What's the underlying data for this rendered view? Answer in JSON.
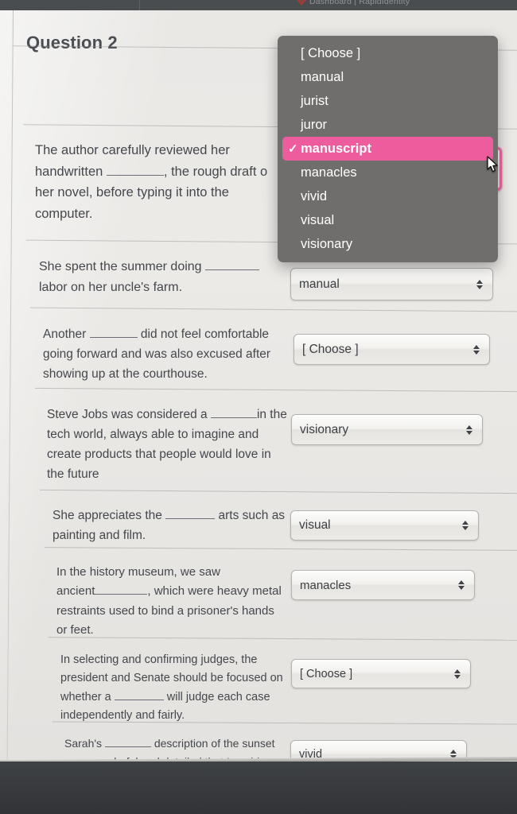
{
  "browser": {
    "title": "Dashboard | RapidIdentity",
    "logo_icon": "red-logo-icon"
  },
  "page": {
    "heading": "Question 2"
  },
  "dropdown": {
    "open": true,
    "selected_value": "manuscript",
    "check_glyph": "✓",
    "highlight_color": "#ed5d9e",
    "background_color": "#6f6e6c",
    "options": [
      "[ Choose ]",
      "manual",
      "jurist",
      "juror",
      "manuscript",
      "manacles",
      "vivid",
      "visual",
      "visionary"
    ]
  },
  "questions": [
    {
      "id": "q-manuscript",
      "text_parts": [
        "The author carefully reviewed her handwritten ",
        "BLANK",
        ", the rough draft of her novel, before typing it into the computer."
      ],
      "select_value": "[ Choose ]",
      "focused": true
    },
    {
      "id": "q-manual",
      "text_parts": [
        "She spent the summer doing ",
        "BLANK",
        " labor on her uncle's farm."
      ],
      "select_value": "manual",
      "focused": false
    },
    {
      "id": "q-juror",
      "text_parts": [
        "Another ",
        "BLANK",
        " did not feel comfortable going forward and was also excused after showing up at the courthouse."
      ],
      "select_value": "[ Choose ]",
      "focused": false
    },
    {
      "id": "q-visionary",
      "text_parts": [
        "Steve Jobs was considered a ",
        "BLANK",
        " in the tech world, always able to imagine and create products that people would love in the future"
      ],
      "select_value": "visionary",
      "focused": false
    },
    {
      "id": "q-visual",
      "text_parts": [
        "She appreciates the ",
        "BLANK",
        " arts such as painting and film."
      ],
      "select_value": "visual",
      "focused": false
    },
    {
      "id": "q-manacles",
      "text_parts": [
        "In the history museum, we saw ancient",
        "BLANK",
        ", which were heavy metal restraints used to bind a prisoner's hands or feet."
      ],
      "select_value": "manacles",
      "focused": false
    },
    {
      "id": "q-jurist",
      "text_parts": [
        "In selecting and confirming judges, the president and Senate should be focused on whether a ",
        "BLANK",
        " will judge each case independently and fairly."
      ],
      "select_value": "[ Choose ]",
      "focused": false
    },
    {
      "id": "q-vivid",
      "text_parts": [
        "Sarah's ",
        "BLANK",
        " description of the sunset was so colorful and detailed that I could"
      ],
      "select_value": "vivid",
      "focused": false
    }
  ],
  "q1": {
    "line1": "The author carefully reviewed her",
    "line2a": "handwritten",
    "line2b": ", the rough draft o",
    "line3": "her novel, before typing it into the",
    "line4": "computer."
  },
  "q2": {
    "line1a": "She spent the summer doing",
    "line2": "labor on her uncle's farm.",
    "value": "manual"
  },
  "q3": {
    "line1a": "Another",
    "line1b": "did not feel comfortable",
    "line2": "going forward and was also excused after",
    "line3": "showing up at the courthouse.",
    "value": "[ Choose ]"
  },
  "q4": {
    "line1a": "Steve Jobs was considered a",
    "line1b": "in the",
    "line2": "tech world, always able to imagine and",
    "line3": "create products that people would love in",
    "line4": "the future",
    "value": "visionary"
  },
  "q5": {
    "line1a": "She appreciates the",
    "line1b": "arts such as",
    "line2": "painting and film.",
    "value": "visual"
  },
  "q6": {
    "line1": "In the history museum, we saw",
    "line2a": "ancient",
    "line2b": ", which were heavy metal",
    "line3": "restraints used to bind a prisoner's hands",
    "line4": "or feet.",
    "value": "manacles"
  },
  "q7": {
    "line1": "In selecting and confirming judges, the",
    "line2": "president and Senate should be focused on",
    "line3a": "whether a",
    "line3b": "will judge each case",
    "line4": "independently and fairly.",
    "value": "[ Choose ]"
  },
  "q8": {
    "line1a": "Sarah's",
    "line1b": "description of the sunset",
    "line2": "was so colorful and detailed that I could",
    "value": "vivid"
  }
}
